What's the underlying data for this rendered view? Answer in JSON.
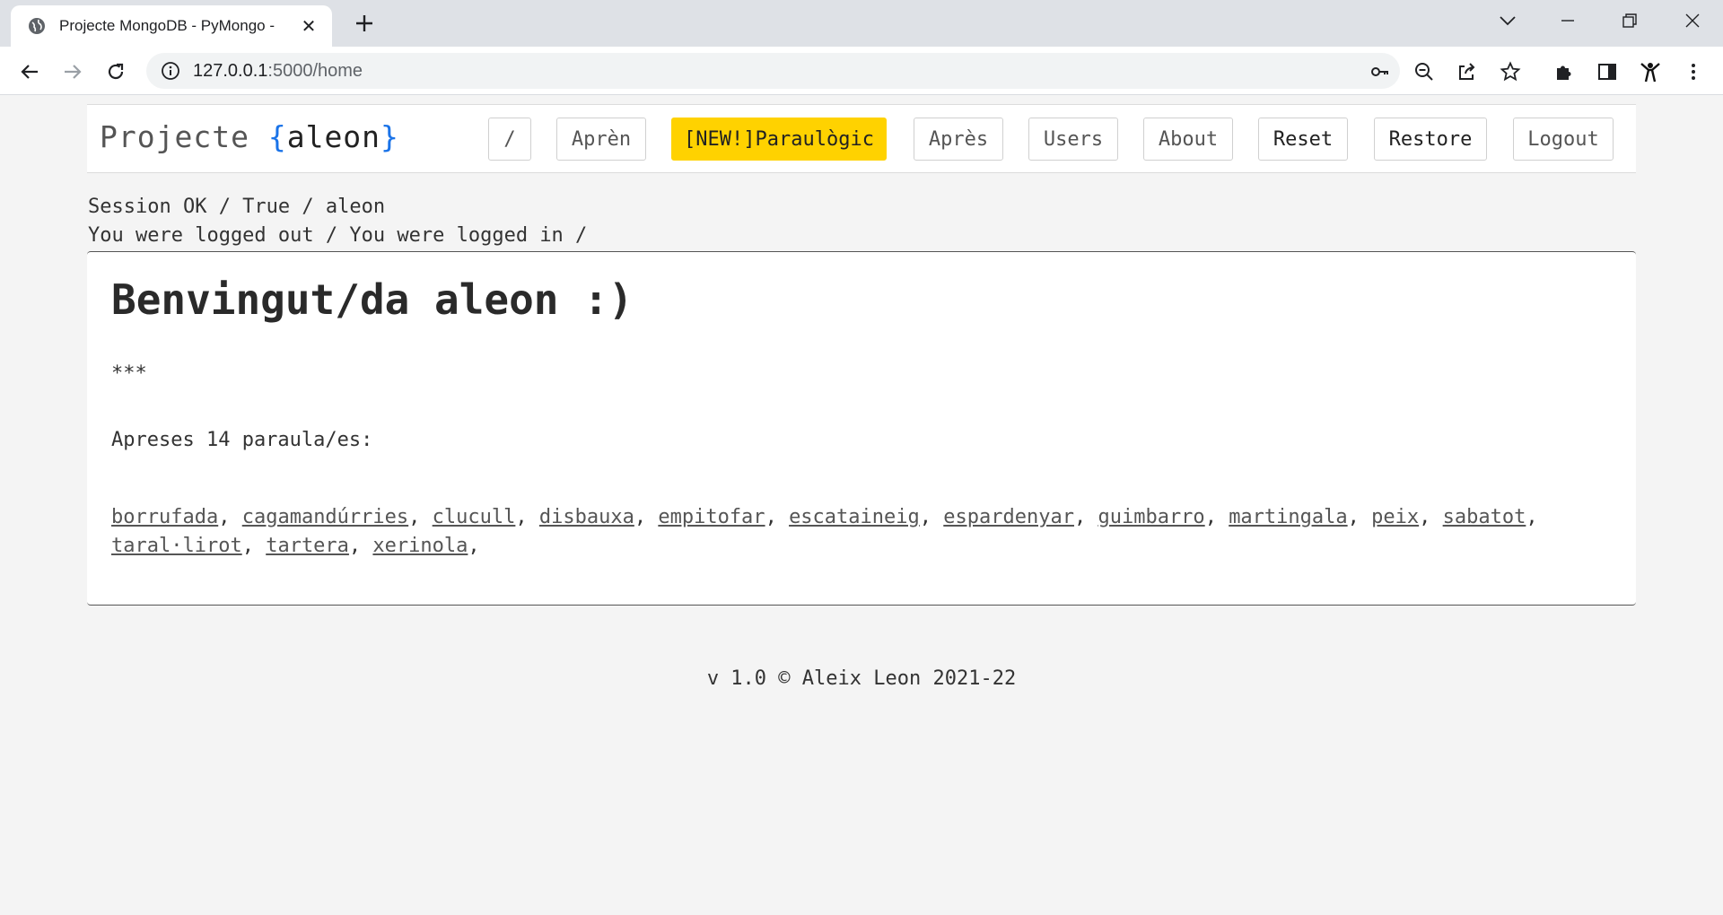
{
  "browser": {
    "tab_title": "Projecte MongoDB - PyMongo -",
    "url_host": "127.0.0.1",
    "url_path": ":5000/home"
  },
  "brand": {
    "name": "Projecte",
    "open_brace": "{",
    "user": "aleon",
    "close_brace": "}",
    "brace_color": "#1a73e8"
  },
  "nav": {
    "items": [
      {
        "label": "/"
      },
      {
        "label": "Aprèn"
      },
      {
        "label": "[NEW!]Paraulògic"
      },
      {
        "label": "Après"
      },
      {
        "label": "Users"
      },
      {
        "label": "About"
      },
      {
        "label": "Reset"
      },
      {
        "label": "Restore"
      },
      {
        "label": "Logout"
      }
    ],
    "highlight_color": "#ffd200"
  },
  "session": {
    "line1": "Session OK / True / aleon",
    "line2": "You were logged out / You were logged in /"
  },
  "main": {
    "heading": "Benvingut/da aleon :)",
    "stars": "***",
    "learned_summary": "Apreses 14 paraula/es:",
    "words": [
      "borrufada",
      "cagamandúrries",
      "clucull",
      "disbauxa",
      "empitofar",
      "escataineig",
      "espardenyar",
      "guimbarro",
      "martingala",
      "peix",
      "sabatot",
      "taral·lirot",
      "tartera",
      "xerinola"
    ],
    "separator": ","
  },
  "footer": {
    "text": "v 1.0 © Aleix Leon 2021-22"
  }
}
